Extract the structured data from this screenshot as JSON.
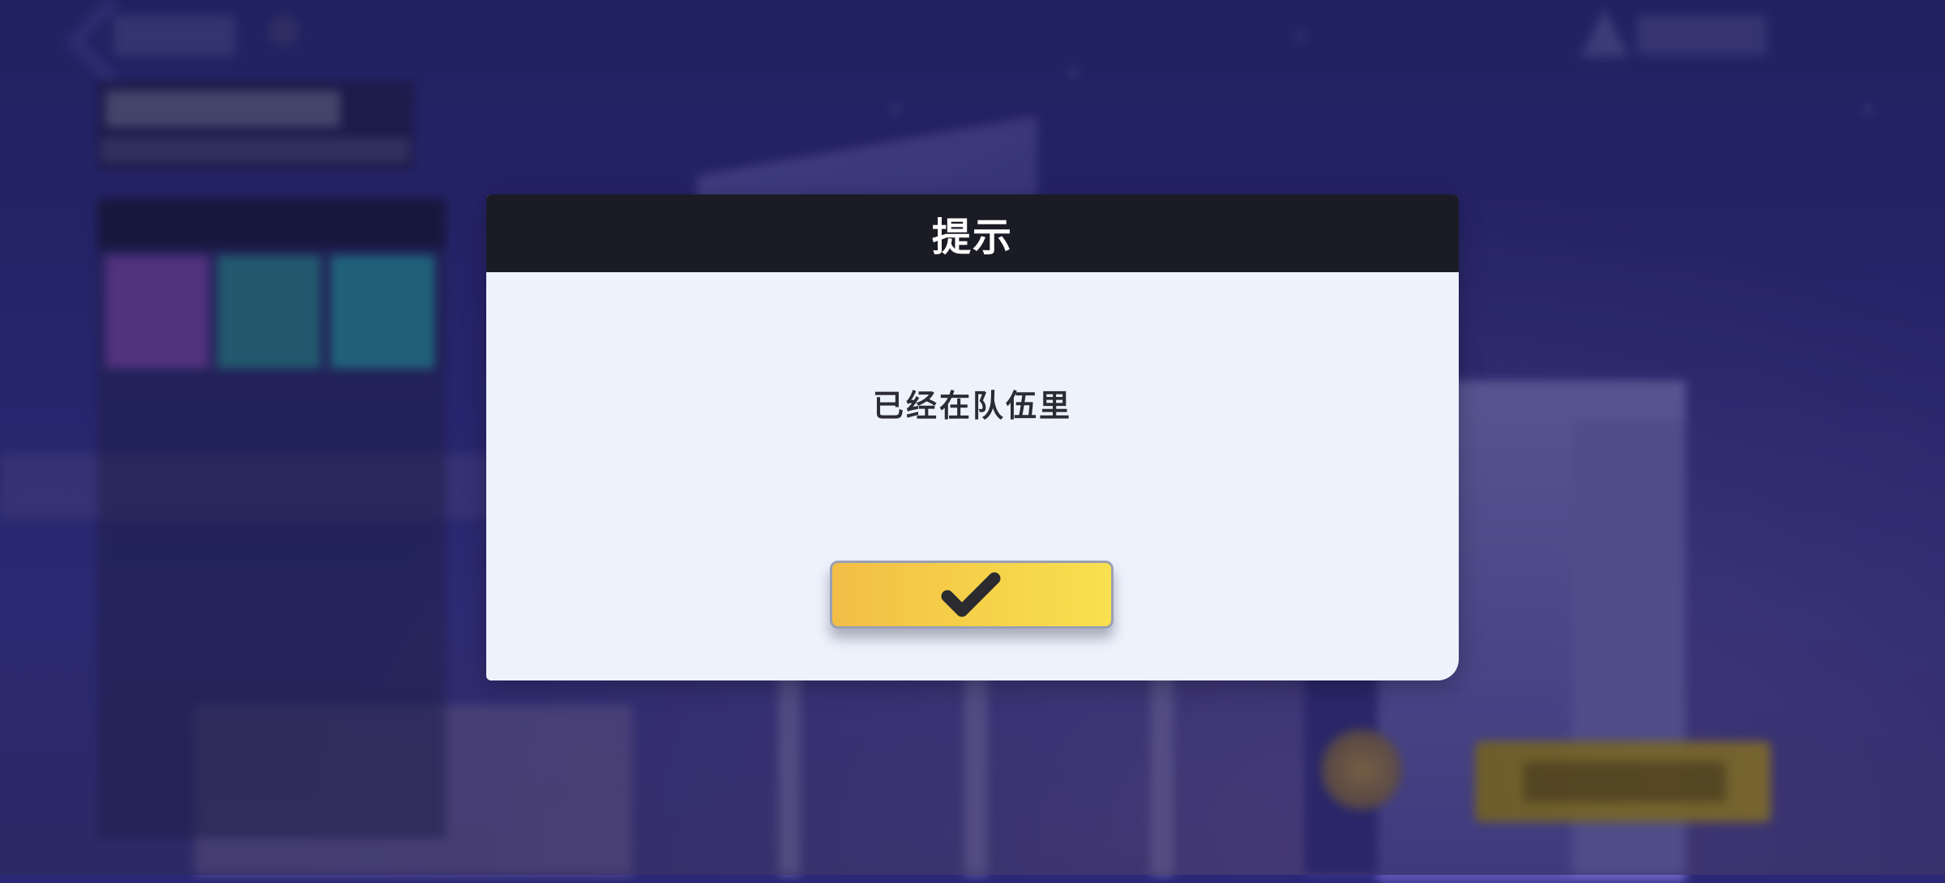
{
  "dialog": {
    "title": "提示",
    "message": "已经在队伍里",
    "confirm_icon": "check-icon"
  },
  "colors": {
    "header_bg": "#1b1b25",
    "dialog_bg": "#eef2fc",
    "button_start": "#f2be46",
    "button_end": "#f8e04e",
    "scene_bg": "#2d2b86"
  }
}
